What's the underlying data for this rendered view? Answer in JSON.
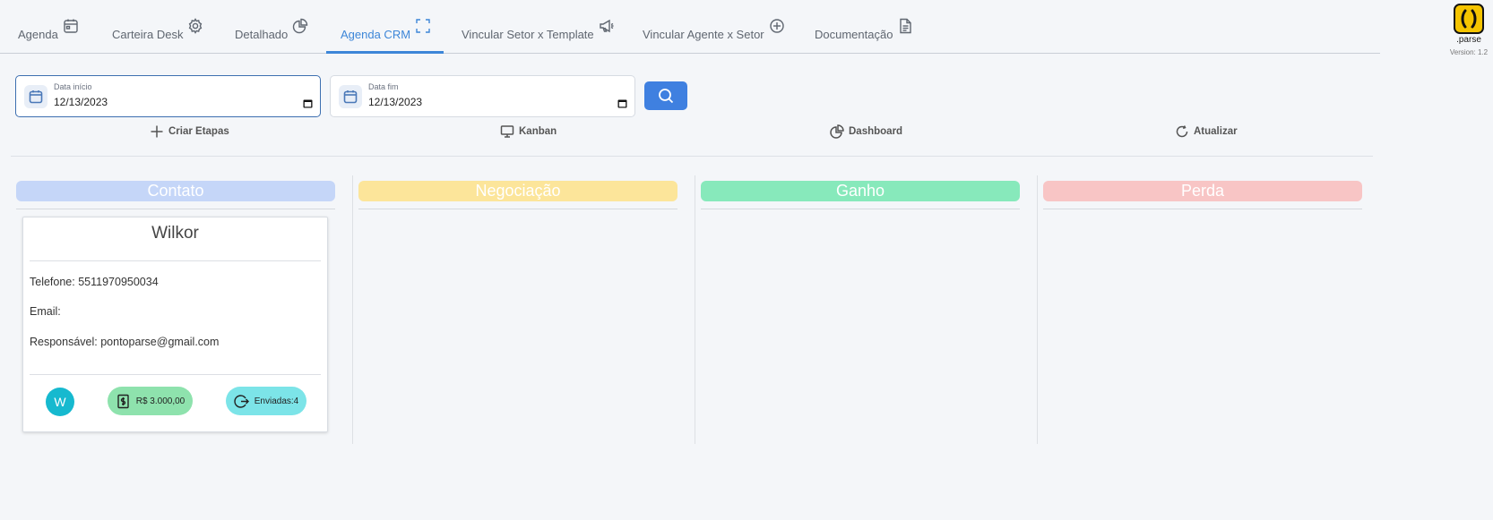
{
  "tabs": [
    {
      "label": "Agenda",
      "icon": "calendar-icon"
    },
    {
      "label": "Carteira Desk",
      "icon": "gear-icon"
    },
    {
      "label": "Detalhado",
      "icon": "pie-chart-icon"
    },
    {
      "label": "Agenda CRM",
      "icon": "fullscreen-icon",
      "active": true
    },
    {
      "label": "Vincular Setor x Template",
      "icon": "megaphone-icon"
    },
    {
      "label": "Vincular Agente x Setor",
      "icon": "plus-circle-icon"
    },
    {
      "label": "Documentação",
      "icon": "document-icon"
    }
  ],
  "logo": {
    "name": ".parse",
    "version": "Version: 1.2"
  },
  "filters": {
    "start": {
      "label": "Data início",
      "value": "12/13/2023"
    },
    "end": {
      "label": "Data fim",
      "value": "12/13/2023"
    }
  },
  "actions": {
    "create_stages": "Criar Etapas",
    "kanban": "Kanban",
    "dashboard": "Dashboard",
    "refresh": "Atualizar"
  },
  "columns": [
    {
      "title": "Contato",
      "color": "#c5d6f8"
    },
    {
      "title": "Negociação",
      "color": "#fce59a"
    },
    {
      "title": "Ganho",
      "color": "#87e9bb"
    },
    {
      "title": "Perda",
      "color": "#f8c5c5"
    }
  ],
  "card": {
    "name": "Wilkor",
    "phone": "Telefone: 5511970950034",
    "email": "Email:",
    "owner": "Responsável: pontoparse@gmail.com",
    "avatar_initial": "W",
    "value": "R$ 3.000,00",
    "sent": "Enviadas:4"
  }
}
